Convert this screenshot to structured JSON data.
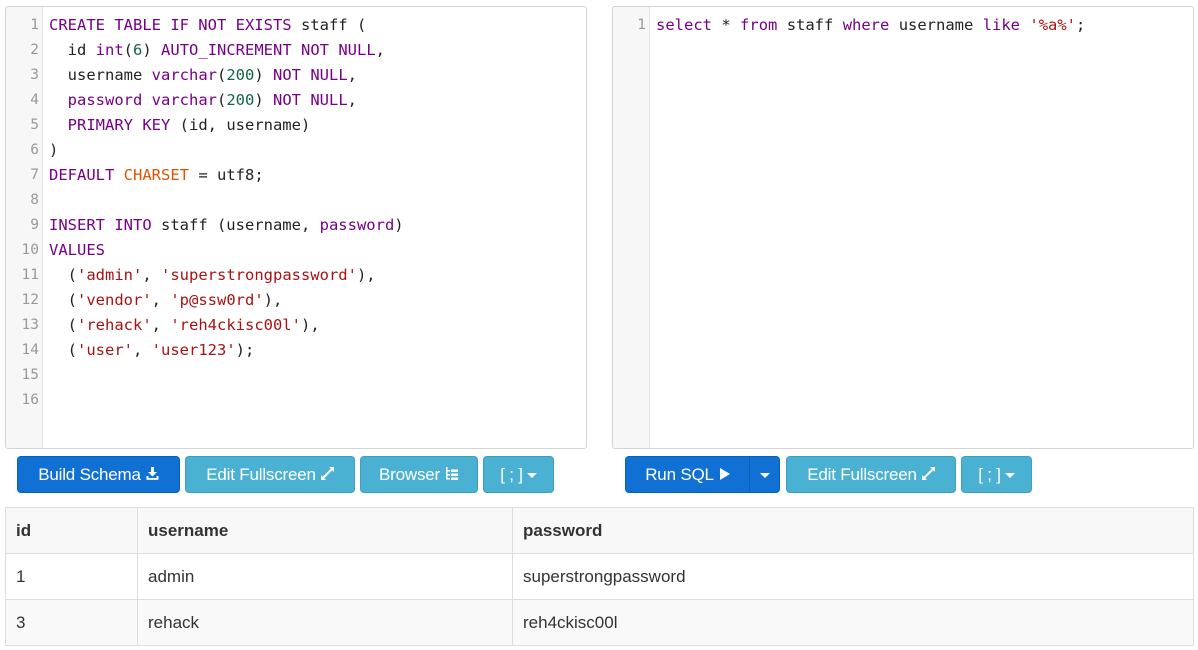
{
  "schema_editor": {
    "lines": [
      {
        "num": "1",
        "tokens": [
          {
            "t": "CREATE TABLE IF NOT EXISTS",
            "c": "kw"
          },
          {
            "t": " staff (",
            "c": "ident"
          }
        ]
      },
      {
        "num": "2",
        "tokens": [
          {
            "t": "  id ",
            "c": "ident"
          },
          {
            "t": "int",
            "c": "kw"
          },
          {
            "t": "(",
            "c": "pun"
          },
          {
            "t": "6",
            "c": "num"
          },
          {
            "t": ") ",
            "c": "pun"
          },
          {
            "t": "AUTO_INCREMENT NOT NULL",
            "c": "kw"
          },
          {
            "t": ",",
            "c": "pun"
          }
        ]
      },
      {
        "num": "3",
        "tokens": [
          {
            "t": "  username ",
            "c": "ident"
          },
          {
            "t": "varchar",
            "c": "kw"
          },
          {
            "t": "(",
            "c": "pun"
          },
          {
            "t": "200",
            "c": "num"
          },
          {
            "t": ") ",
            "c": "pun"
          },
          {
            "t": "NOT NULL",
            "c": "kw"
          },
          {
            "t": ",",
            "c": "pun"
          }
        ]
      },
      {
        "num": "4",
        "tokens": [
          {
            "t": "  ",
            "c": "ident"
          },
          {
            "t": "password",
            "c": "kw"
          },
          {
            "t": " ",
            "c": "ident"
          },
          {
            "t": "varchar",
            "c": "kw"
          },
          {
            "t": "(",
            "c": "pun"
          },
          {
            "t": "200",
            "c": "num"
          },
          {
            "t": ") ",
            "c": "pun"
          },
          {
            "t": "NOT NULL",
            "c": "kw"
          },
          {
            "t": ",",
            "c": "pun"
          }
        ]
      },
      {
        "num": "5",
        "tokens": [
          {
            "t": "  ",
            "c": "ident"
          },
          {
            "t": "PRIMARY KEY",
            "c": "kw"
          },
          {
            "t": " (id, username)",
            "c": "ident"
          }
        ]
      },
      {
        "num": "6",
        "tokens": [
          {
            "t": ")",
            "c": "pun"
          }
        ]
      },
      {
        "num": "7",
        "tokens": [
          {
            "t": "DEFAULT",
            "c": "kw"
          },
          {
            "t": " ",
            "c": "ident"
          },
          {
            "t": "CHARSET",
            "c": "bi"
          },
          {
            "t": " = utf8;",
            "c": "ident"
          }
        ]
      },
      {
        "num": "8",
        "tokens": []
      },
      {
        "num": "9",
        "tokens": [
          {
            "t": "INSERT INTO",
            "c": "kw"
          },
          {
            "t": " staff (username, ",
            "c": "ident"
          },
          {
            "t": "password",
            "c": "kw"
          },
          {
            "t": ")",
            "c": "pun"
          }
        ]
      },
      {
        "num": "10",
        "tokens": [
          {
            "t": "VALUES",
            "c": "kw"
          }
        ]
      },
      {
        "num": "11",
        "tokens": [
          {
            "t": "  (",
            "c": "pun"
          },
          {
            "t": "'admin'",
            "c": "str"
          },
          {
            "t": ", ",
            "c": "pun"
          },
          {
            "t": "'superstrongpassword'",
            "c": "str"
          },
          {
            "t": "),",
            "c": "pun"
          }
        ]
      },
      {
        "num": "12",
        "tokens": [
          {
            "t": "  (",
            "c": "pun"
          },
          {
            "t": "'vendor'",
            "c": "str"
          },
          {
            "t": ", ",
            "c": "pun"
          },
          {
            "t": "'p@ssw0rd'",
            "c": "str"
          },
          {
            "t": "),",
            "c": "pun"
          }
        ]
      },
      {
        "num": "13",
        "tokens": [
          {
            "t": "  (",
            "c": "pun"
          },
          {
            "t": "'rehack'",
            "c": "str"
          },
          {
            "t": ", ",
            "c": "pun"
          },
          {
            "t": "'reh4ckisc00l'",
            "c": "str"
          },
          {
            "t": "),",
            "c": "pun"
          }
        ]
      },
      {
        "num": "14",
        "tokens": [
          {
            "t": "  (",
            "c": "pun"
          },
          {
            "t": "'user'",
            "c": "str"
          },
          {
            "t": ", ",
            "c": "pun"
          },
          {
            "t": "'user123'",
            "c": "str"
          },
          {
            "t": ");",
            "c": "pun"
          }
        ]
      },
      {
        "num": "15",
        "tokens": []
      },
      {
        "num": "16",
        "tokens": []
      }
    ]
  },
  "query_editor": {
    "lines": [
      {
        "num": "1",
        "tokens": [
          {
            "t": "select",
            "c": "kw"
          },
          {
            "t": " ",
            "c": "ident"
          },
          {
            "t": "*",
            "c": "op"
          },
          {
            "t": " ",
            "c": "ident"
          },
          {
            "t": "from",
            "c": "kw"
          },
          {
            "t": " staff ",
            "c": "ident"
          },
          {
            "t": "where",
            "c": "kw"
          },
          {
            "t": " username ",
            "c": "ident"
          },
          {
            "t": "like",
            "c": "kw"
          },
          {
            "t": " ",
            "c": "ident"
          },
          {
            "t": "'%a%'",
            "c": "str"
          },
          {
            "t": ";",
            "c": "pun"
          }
        ]
      }
    ]
  },
  "toolbar_left": {
    "build_schema_label": "Build Schema",
    "build_schema_icon": "download-icon",
    "edit_fullscreen_label": "Edit Fullscreen",
    "edit_fullscreen_icon": "expand-icon",
    "browser_label": "Browser",
    "browser_icon": "tree-icon",
    "delimiter_label": "[ ; ]"
  },
  "toolbar_right": {
    "run_sql_label": "Run SQL",
    "run_sql_icon": "play-icon",
    "edit_fullscreen_label": "Edit Fullscreen",
    "edit_fullscreen_icon": "expand-icon",
    "delimiter_label": "[ ; ]"
  },
  "results": {
    "columns": [
      "id",
      "username",
      "password"
    ],
    "rows": [
      [
        "1",
        "admin",
        "superstrongpassword"
      ],
      [
        "3",
        "rehack",
        "reh4ckisc00l"
      ]
    ]
  },
  "colors": {
    "primary": "#1170d3",
    "info": "#4bb1d3",
    "keyword": "#770088",
    "number": "#116644",
    "string": "#aa1111",
    "builtin": "#dd5500"
  }
}
